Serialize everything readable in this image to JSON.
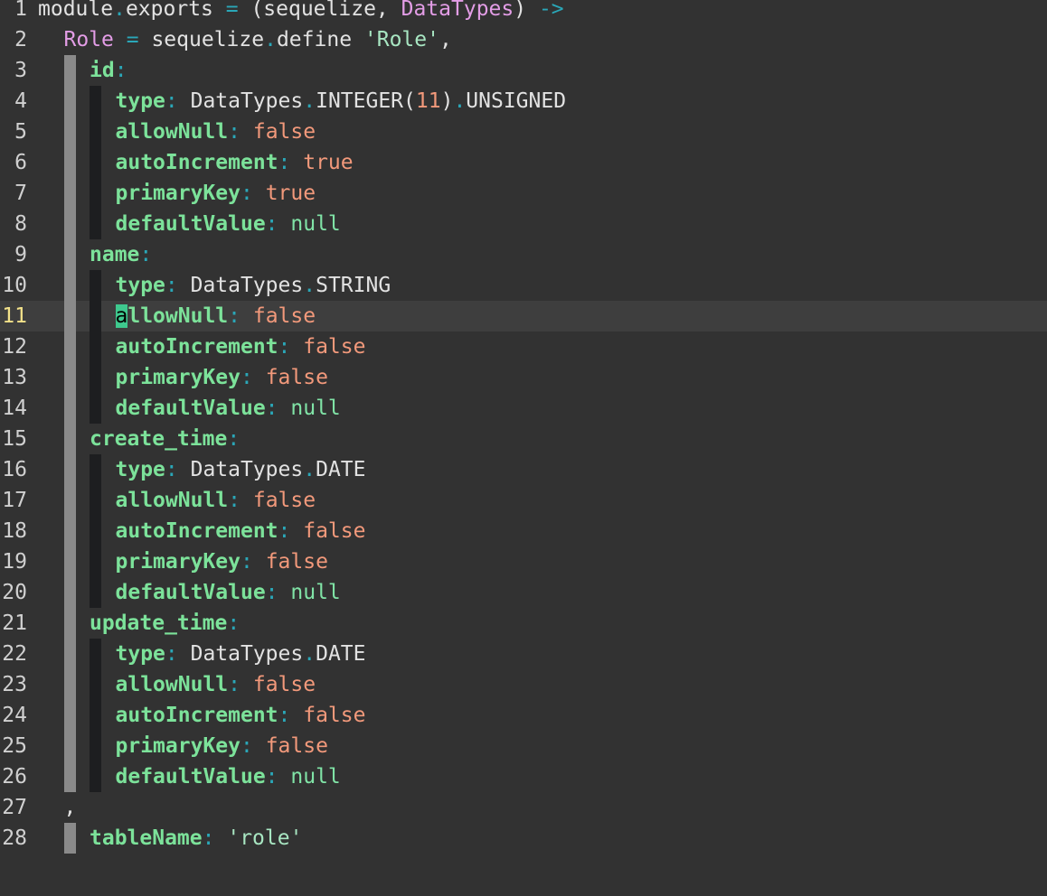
{
  "editor": {
    "active_line": 11,
    "lines": [
      {
        "n": "1",
        "indent": 0,
        "guides": 0,
        "tokens": [
          [
            "plain",
            "module"
          ],
          [
            "teal",
            "."
          ],
          [
            "plain",
            "exports "
          ],
          [
            "teal",
            "="
          ],
          [
            "plain",
            " (sequelize, "
          ],
          [
            "pink",
            "DataTypes"
          ],
          [
            "plain",
            ") "
          ],
          [
            "teal",
            "->"
          ]
        ]
      },
      {
        "n": "2",
        "indent": 1,
        "guides": 0,
        "tokens": [
          [
            "pink",
            "Role"
          ],
          [
            "plain",
            " "
          ],
          [
            "teal",
            "="
          ],
          [
            "plain",
            " sequelize"
          ],
          [
            "teal",
            "."
          ],
          [
            "plain",
            "define "
          ],
          [
            "str",
            "'Role'"
          ],
          [
            "plain",
            ","
          ]
        ]
      },
      {
        "n": "3",
        "indent": 2,
        "guides": 1,
        "tokens": [
          [
            "key",
            "id"
          ],
          [
            "teal",
            ":"
          ]
        ]
      },
      {
        "n": "4",
        "indent": 3,
        "guides": 2,
        "tokens": [
          [
            "key",
            "type"
          ],
          [
            "teal",
            ":"
          ],
          [
            "plain",
            " DataTypes"
          ],
          [
            "teal",
            "."
          ],
          [
            "plain",
            "INTEGER("
          ],
          [
            "num",
            "11"
          ],
          [
            "plain",
            ")"
          ],
          [
            "teal",
            "."
          ],
          [
            "plain",
            "UNSIGNED"
          ]
        ]
      },
      {
        "n": "5",
        "indent": 3,
        "guides": 2,
        "tokens": [
          [
            "key",
            "allowNull"
          ],
          [
            "teal",
            ":"
          ],
          [
            "plain",
            " "
          ],
          [
            "bool",
            "false"
          ]
        ]
      },
      {
        "n": "6",
        "indent": 3,
        "guides": 2,
        "tokens": [
          [
            "key",
            "autoIncrement"
          ],
          [
            "teal",
            ":"
          ],
          [
            "plain",
            " "
          ],
          [
            "bool",
            "true"
          ]
        ]
      },
      {
        "n": "7",
        "indent": 3,
        "guides": 2,
        "tokens": [
          [
            "key",
            "primaryKey"
          ],
          [
            "teal",
            ":"
          ],
          [
            "plain",
            " "
          ],
          [
            "bool",
            "true"
          ]
        ]
      },
      {
        "n": "8",
        "indent": 3,
        "guides": 2,
        "tokens": [
          [
            "key",
            "defaultValue"
          ],
          [
            "teal",
            ":"
          ],
          [
            "plain",
            " "
          ],
          [
            "null",
            "null"
          ]
        ]
      },
      {
        "n": "9",
        "indent": 2,
        "guides": 1,
        "tokens": [
          [
            "key",
            "name"
          ],
          [
            "teal",
            ":"
          ]
        ]
      },
      {
        "n": "10",
        "indent": 3,
        "guides": 2,
        "tokens": [
          [
            "key",
            "type"
          ],
          [
            "teal",
            ":"
          ],
          [
            "plain",
            " DataTypes"
          ],
          [
            "teal",
            "."
          ],
          [
            "plain",
            "STRING"
          ]
        ]
      },
      {
        "n": "11",
        "indent": 3,
        "guides": 2,
        "cursor": true,
        "tokens": [
          [
            "cursor",
            "a"
          ],
          [
            "key",
            "llowNull"
          ],
          [
            "teal",
            ":"
          ],
          [
            "plain",
            " "
          ],
          [
            "bool",
            "false"
          ]
        ]
      },
      {
        "n": "12",
        "indent": 3,
        "guides": 2,
        "tokens": [
          [
            "key",
            "autoIncrement"
          ],
          [
            "teal",
            ":"
          ],
          [
            "plain",
            " "
          ],
          [
            "bool",
            "false"
          ]
        ]
      },
      {
        "n": "13",
        "indent": 3,
        "guides": 2,
        "tokens": [
          [
            "key",
            "primaryKey"
          ],
          [
            "teal",
            ":"
          ],
          [
            "plain",
            " "
          ],
          [
            "bool",
            "false"
          ]
        ]
      },
      {
        "n": "14",
        "indent": 3,
        "guides": 2,
        "tokens": [
          [
            "key",
            "defaultValue"
          ],
          [
            "teal",
            ":"
          ],
          [
            "plain",
            " "
          ],
          [
            "null",
            "null"
          ]
        ]
      },
      {
        "n": "15",
        "indent": 2,
        "guides": 1,
        "tokens": [
          [
            "key",
            "create_time"
          ],
          [
            "teal",
            ":"
          ]
        ]
      },
      {
        "n": "16",
        "indent": 3,
        "guides": 2,
        "tokens": [
          [
            "key",
            "type"
          ],
          [
            "teal",
            ":"
          ],
          [
            "plain",
            " DataTypes"
          ],
          [
            "teal",
            "."
          ],
          [
            "plain",
            "DATE"
          ]
        ]
      },
      {
        "n": "17",
        "indent": 3,
        "guides": 2,
        "tokens": [
          [
            "key",
            "allowNull"
          ],
          [
            "teal",
            ":"
          ],
          [
            "plain",
            " "
          ],
          [
            "bool",
            "false"
          ]
        ]
      },
      {
        "n": "18",
        "indent": 3,
        "guides": 2,
        "tokens": [
          [
            "key",
            "autoIncrement"
          ],
          [
            "teal",
            ":"
          ],
          [
            "plain",
            " "
          ],
          [
            "bool",
            "false"
          ]
        ]
      },
      {
        "n": "19",
        "indent": 3,
        "guides": 2,
        "tokens": [
          [
            "key",
            "primaryKey"
          ],
          [
            "teal",
            ":"
          ],
          [
            "plain",
            " "
          ],
          [
            "bool",
            "false"
          ]
        ]
      },
      {
        "n": "20",
        "indent": 3,
        "guides": 2,
        "tokens": [
          [
            "key",
            "defaultValue"
          ],
          [
            "teal",
            ":"
          ],
          [
            "plain",
            " "
          ],
          [
            "null",
            "null"
          ]
        ]
      },
      {
        "n": "21",
        "indent": 2,
        "guides": 1,
        "tokens": [
          [
            "key",
            "update_time"
          ],
          [
            "teal",
            ":"
          ]
        ]
      },
      {
        "n": "22",
        "indent": 3,
        "guides": 2,
        "tokens": [
          [
            "key",
            "type"
          ],
          [
            "teal",
            ":"
          ],
          [
            "plain",
            " DataTypes"
          ],
          [
            "teal",
            "."
          ],
          [
            "plain",
            "DATE"
          ]
        ]
      },
      {
        "n": "23",
        "indent": 3,
        "guides": 2,
        "tokens": [
          [
            "key",
            "allowNull"
          ],
          [
            "teal",
            ":"
          ],
          [
            "plain",
            " "
          ],
          [
            "bool",
            "false"
          ]
        ]
      },
      {
        "n": "24",
        "indent": 3,
        "guides": 2,
        "tokens": [
          [
            "key",
            "autoIncrement"
          ],
          [
            "teal",
            ":"
          ],
          [
            "plain",
            " "
          ],
          [
            "bool",
            "false"
          ]
        ]
      },
      {
        "n": "25",
        "indent": 3,
        "guides": 2,
        "tokens": [
          [
            "key",
            "primaryKey"
          ],
          [
            "teal",
            ":"
          ],
          [
            "plain",
            " "
          ],
          [
            "bool",
            "false"
          ]
        ]
      },
      {
        "n": "26",
        "indent": 3,
        "guides": 2,
        "tokens": [
          [
            "key",
            "defaultValue"
          ],
          [
            "teal",
            ":"
          ],
          [
            "plain",
            " "
          ],
          [
            "null",
            "null"
          ]
        ]
      },
      {
        "n": "27",
        "indent": 1,
        "guides": 0,
        "tokens": [
          [
            "plain",
            ","
          ]
        ]
      },
      {
        "n": "28",
        "indent": 2,
        "guides": 1,
        "tokens": [
          [
            "key",
            "tableName"
          ],
          [
            "teal",
            ":"
          ],
          [
            "plain",
            " "
          ],
          [
            "str",
            "'role'"
          ]
        ]
      }
    ]
  },
  "colors": {
    "background": "#323232",
    "active_line": "#3e3e3e",
    "cursor": "#3ec98e",
    "keyword_pink": "#e39de6",
    "operator_teal": "#2aa7b8",
    "key_green": "#7ce29a",
    "literal_orange": "#f2997b"
  }
}
